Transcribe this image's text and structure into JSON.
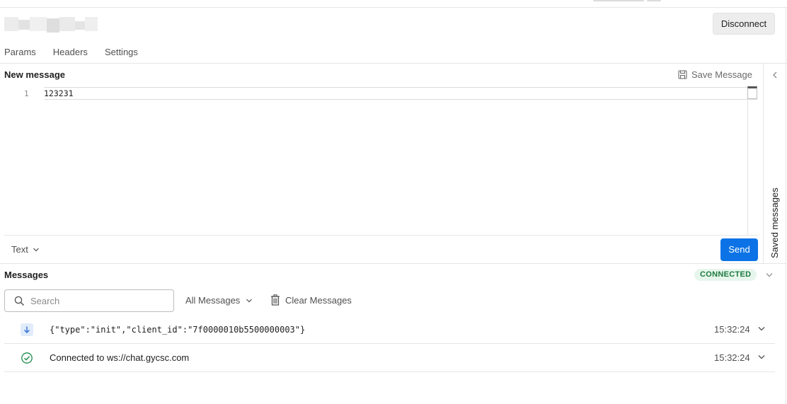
{
  "toolbar": {
    "disconnect_label": "Disconnect"
  },
  "tabs": [
    {
      "label": "Params"
    },
    {
      "label": "Headers"
    },
    {
      "label": "Settings"
    }
  ],
  "composer": {
    "title": "New message",
    "save_label": "Save Message",
    "line_number": "1",
    "content": "123231",
    "format_label": "Text",
    "send_label": "Send"
  },
  "side_panel": {
    "label": "Saved messages"
  },
  "messages": {
    "title": "Messages",
    "status": "CONNECTED",
    "search_placeholder": "Search",
    "filter_label": "All Messages",
    "clear_label": "Clear Messages",
    "items": [
      {
        "icon": "arrow-down-icon",
        "text": "{\"type\":\"init\",\"client_id\":\"7f0000010b5500000003\"}",
        "time": "15:32:24"
      },
      {
        "icon": "check-circle-icon",
        "text": "Connected to ws://chat.gycsc.com",
        "time": "15:32:24"
      }
    ]
  },
  "colors": {
    "accent": "#0b73e6",
    "connected_bg": "#e7f6ec",
    "connected_text": "#1b7a3e",
    "success": "#1b8a4a"
  }
}
